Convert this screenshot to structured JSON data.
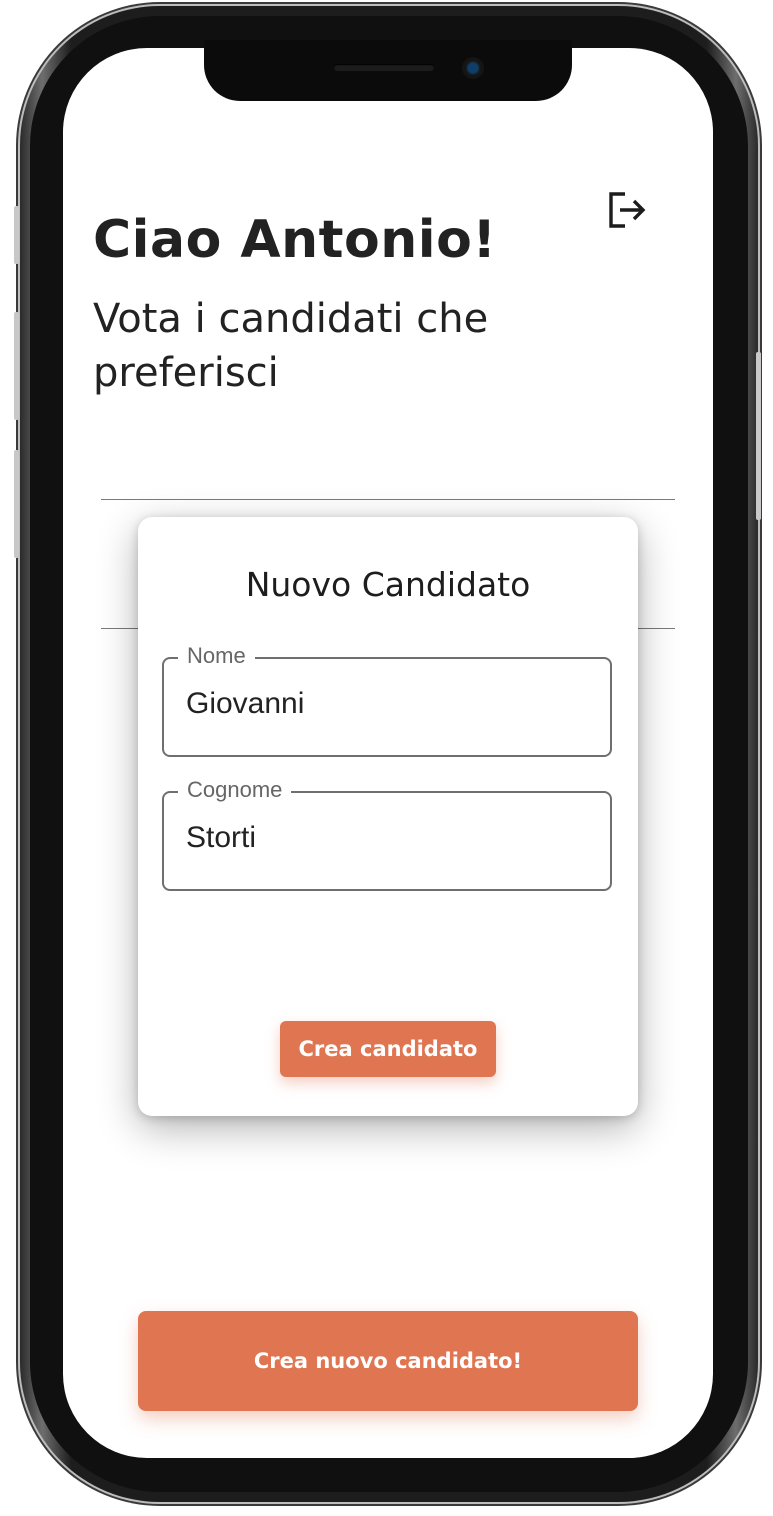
{
  "header": {
    "greeting": "Ciao Antonio!",
    "subtitle": "Vota i candidati che preferisci",
    "logout_icon": "logout-icon"
  },
  "dialog": {
    "title": "Nuovo Candidato",
    "fields": [
      {
        "label": "Nome",
        "value": "Giovanni"
      },
      {
        "label": "Cognome",
        "value": "Storti"
      }
    ],
    "submit_label": "Crea candidato"
  },
  "footer": {
    "new_candidate_label": "Crea nuovo candidato!"
  },
  "colors": {
    "accent": "#e07551",
    "text": "#222222",
    "field_border": "#6f6f6f",
    "label": "#666666"
  }
}
